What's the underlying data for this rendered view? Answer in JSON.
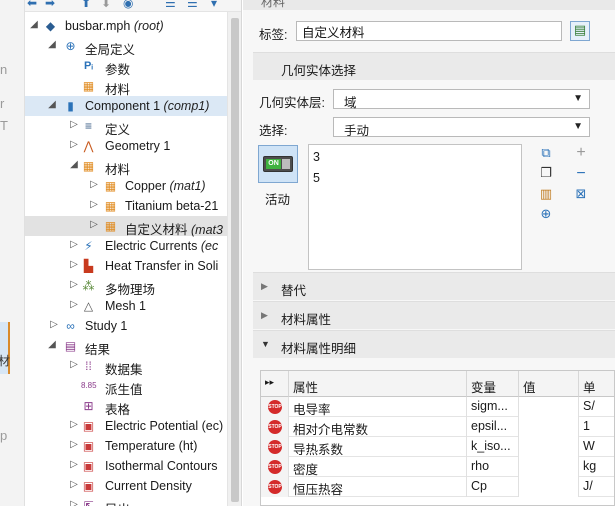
{
  "edge_strip": {
    "fragments": [
      "n",
      "r",
      "T",
      "材",
      "p"
    ]
  },
  "tree": {
    "items": [
      {
        "label": "busbar.mph",
        "tag": "(root)"
      },
      {
        "label": "全局定义",
        "tag": ""
      },
      {
        "label": "参数",
        "tag": ""
      },
      {
        "label": "材料",
        "tag": ""
      },
      {
        "label": "Component 1",
        "tag": "(comp1)"
      },
      {
        "label": "定义",
        "tag": ""
      },
      {
        "label": "Geometry 1",
        "tag": ""
      },
      {
        "label": "材料",
        "tag": ""
      },
      {
        "label": "Copper",
        "tag": "(mat1)"
      },
      {
        "label": "Titanium beta-21",
        "tag": ""
      },
      {
        "label": "自定义材料",
        "tag": "(mat3"
      },
      {
        "label": "Electric Currents",
        "tag": "(ec"
      },
      {
        "label": "Heat Transfer in Soli",
        "tag": ""
      },
      {
        "label": "多物理场",
        "tag": ""
      },
      {
        "label": "Mesh 1",
        "tag": ""
      },
      {
        "label": "Study 1",
        "tag": ""
      },
      {
        "label": "结果",
        "tag": ""
      },
      {
        "label": "数据集",
        "tag": ""
      },
      {
        "label": "派生值",
        "tag": ""
      },
      {
        "label": "表格",
        "tag": ""
      },
      {
        "label": "Electric Potential",
        "tag": "(ec)"
      },
      {
        "label": "Temperature",
        "tag": "(ht)"
      },
      {
        "label": "Isothermal Contours",
        "tag": ""
      },
      {
        "label": "Current Density",
        "tag": ""
      },
      {
        "label": "导出",
        "tag": ""
      }
    ]
  },
  "settings": {
    "header_title": "材料",
    "label_caption": "标签:",
    "label_value": "自定义材料",
    "sections": {
      "geometry": "几何实体选择",
      "substitute": "替代",
      "properties": "材料属性",
      "details": "材料属性明细"
    },
    "geometry_level_caption": "几何实体层:",
    "geometry_level_value": "域",
    "selection_caption": "选择:",
    "selection_value": "手动",
    "toggle_on_text": "ON",
    "active_label": "活动",
    "selection_items": [
      "3",
      "5"
    ]
  },
  "table": {
    "headers": {
      "property": "属性",
      "variable": "变量",
      "value": "值",
      "unit": "单"
    },
    "stop_text": "STOP",
    "rows": [
      {
        "property": "电导率",
        "variable": "sigm...",
        "value": "",
        "unit": "S/"
      },
      {
        "property": "相对介电常数",
        "variable": "epsil...",
        "value": "",
        "unit": "1"
      },
      {
        "property": "导热系数",
        "variable": "k_iso...",
        "value": "",
        "unit": "W"
      },
      {
        "property": "密度",
        "variable": "rho",
        "value": "",
        "unit": "kg"
      },
      {
        "property": "恒压热容",
        "variable": "Cp",
        "value": "",
        "unit": "J/"
      }
    ]
  }
}
